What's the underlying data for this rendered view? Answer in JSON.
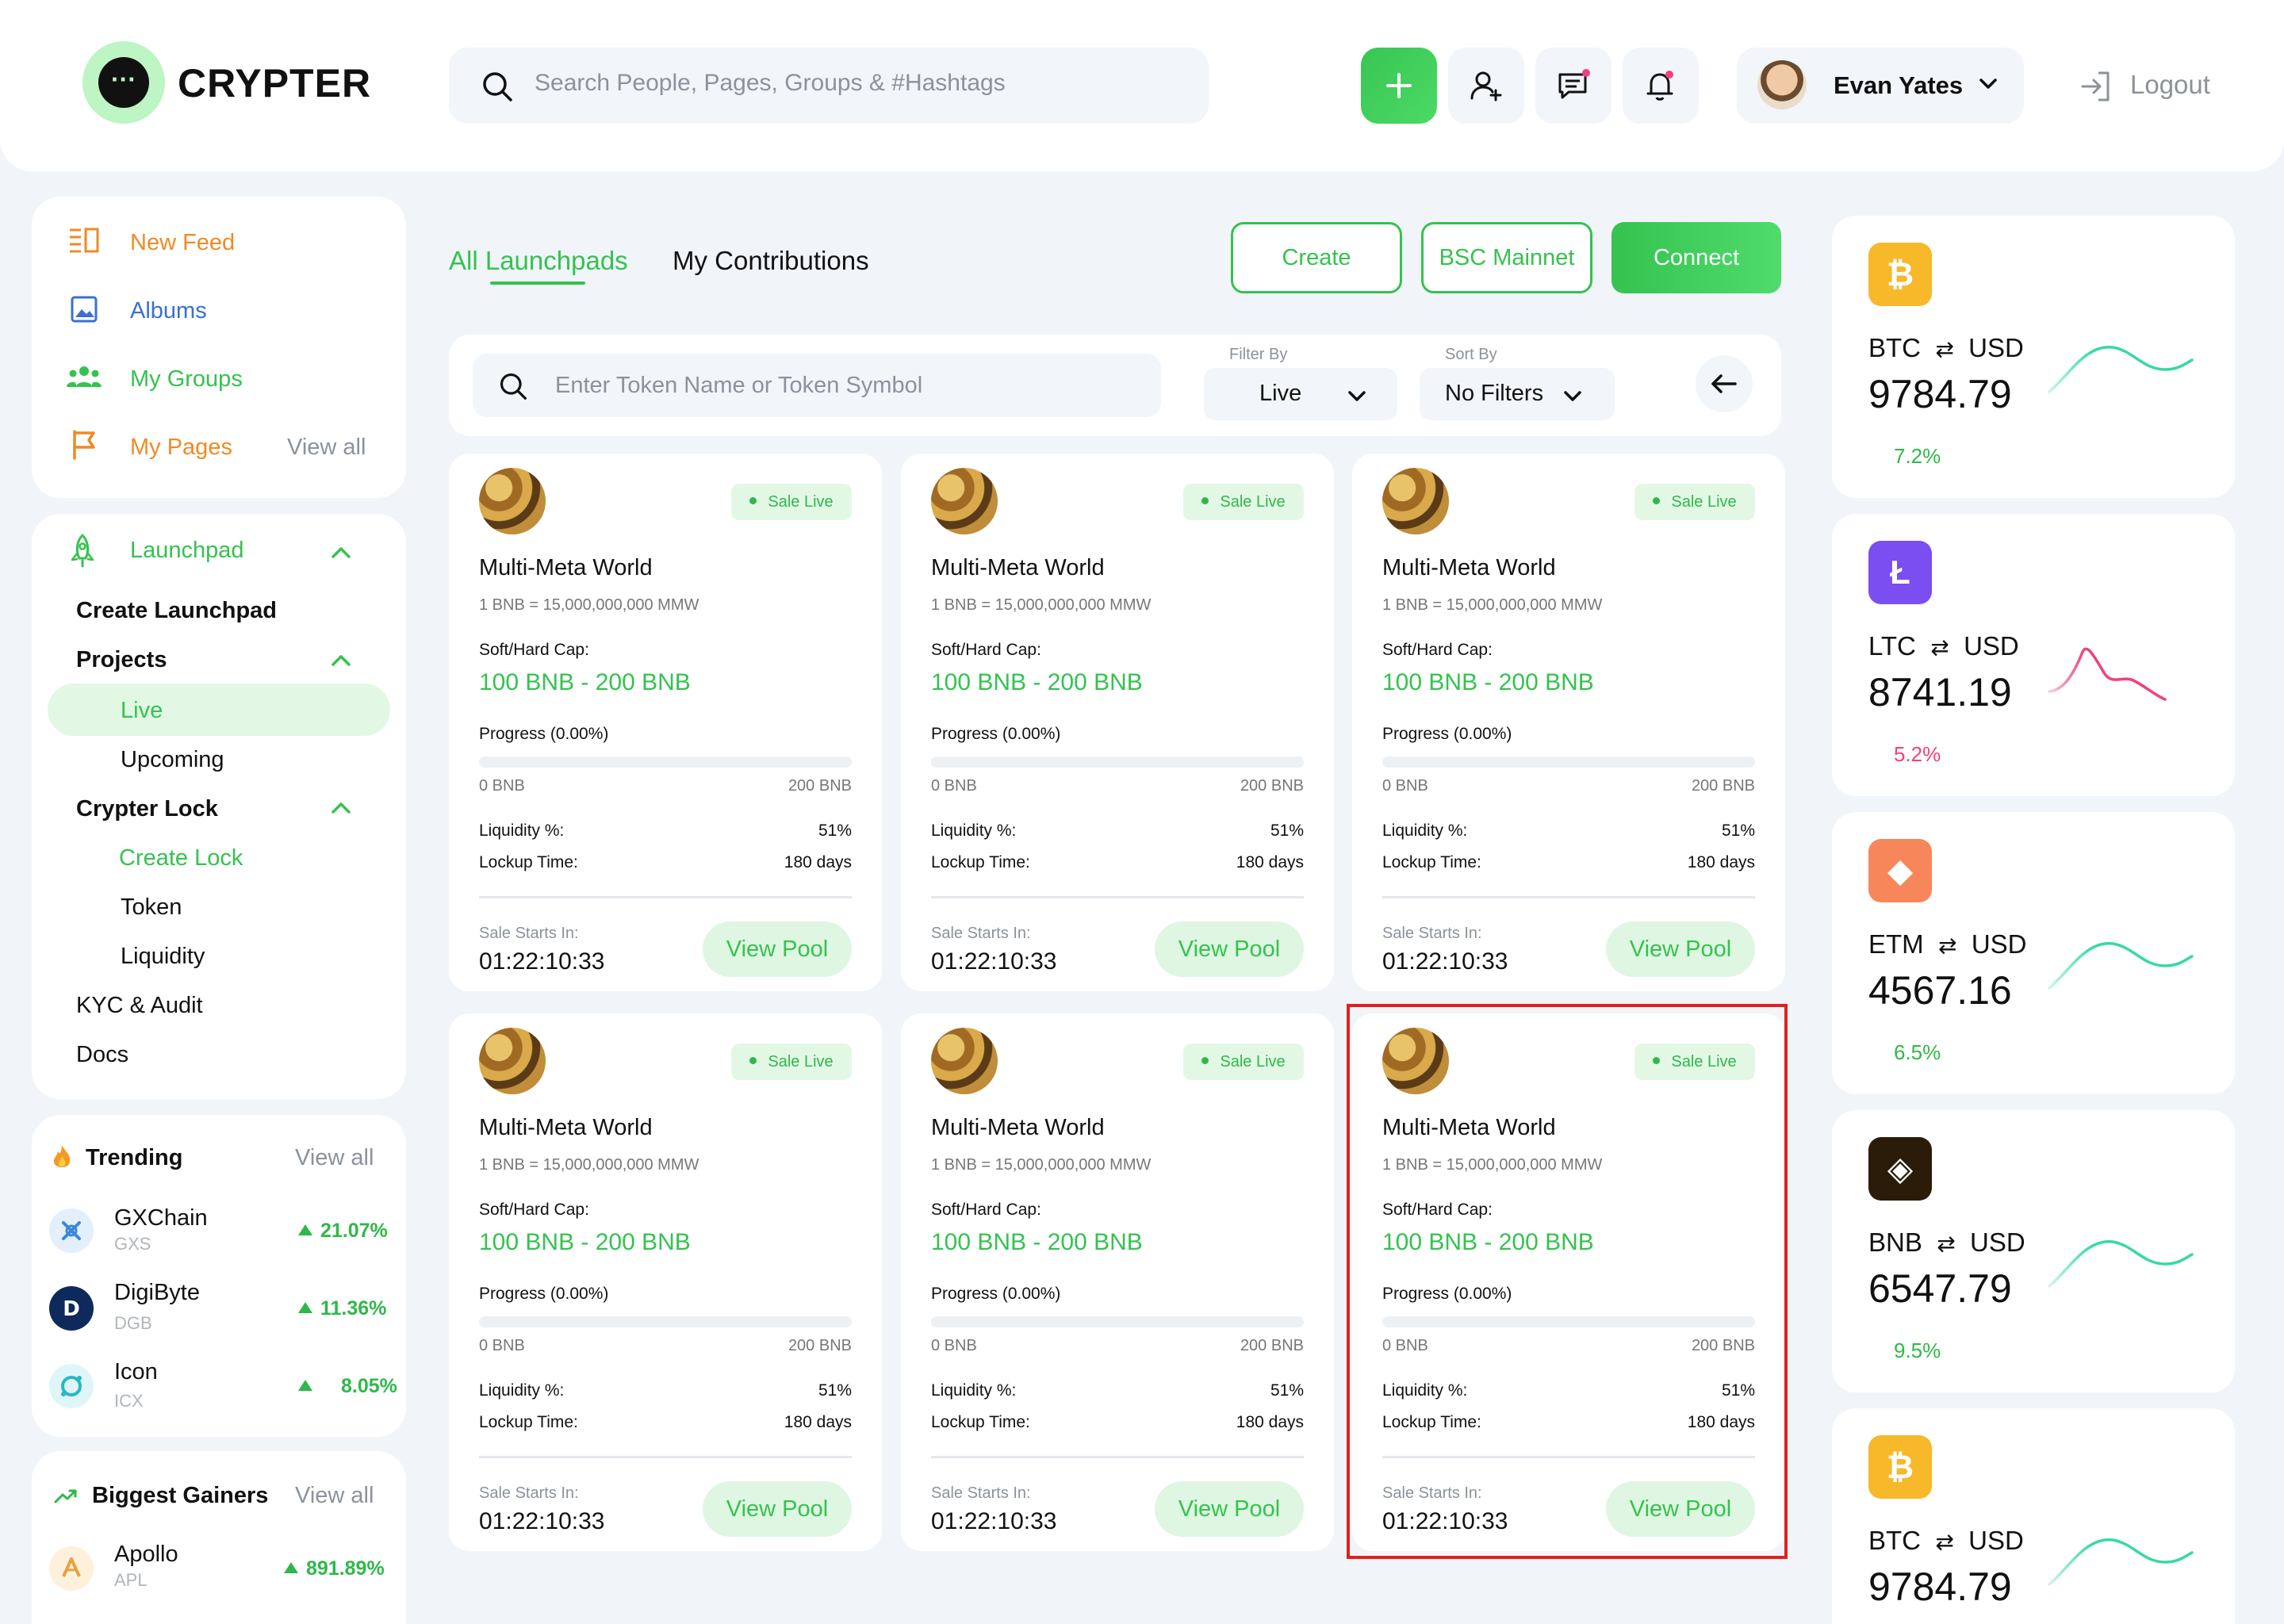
{
  "header": {
    "logo_text": "CRYPTER",
    "logo_mark": "···",
    "search_placeholder": "Search People, Pages, Groups & #Hashtags",
    "user_name": "Evan Yates",
    "logout_label": "Logout"
  },
  "sidebar": {
    "main_nav": [
      {
        "label": "New Feed",
        "icon": "feed-icon"
      },
      {
        "label": "Albums",
        "icon": "image-icon"
      },
      {
        "label": "My Groups",
        "icon": "group-icon"
      },
      {
        "label": "My Pages",
        "icon": "flag-icon"
      }
    ],
    "view_all": "View all",
    "launchpad": {
      "title": "Launchpad",
      "create_launchpad": "Create Launchpad",
      "projects": "Projects",
      "live": "Live",
      "upcoming": "Upcoming",
      "crypter_lock": "Crypter Lock",
      "create_lock": "Create Lock",
      "token": "Token",
      "liquidity": "Liquidity",
      "kyc": "KYC & Audit",
      "docs": "Docs"
    },
    "trending": {
      "title": "Trending",
      "view_all": "View all",
      "items": [
        {
          "name": "GXChain",
          "symbol": "GXS",
          "change": "21.07%"
        },
        {
          "name": "DigiByte",
          "symbol": "DGB",
          "change": "11.36%"
        },
        {
          "name": "Icon",
          "symbol": "ICX",
          "change": "8.05%"
        }
      ]
    },
    "gainers": {
      "title": "Biggest Gainers",
      "view_all": "View all",
      "items": [
        {
          "name": "Apollo",
          "symbol": "APL",
          "change": "891.89%"
        }
      ]
    }
  },
  "tabs": {
    "all": "All Launchpads",
    "mine": "My Contributions"
  },
  "actions": {
    "create": "Create",
    "network": "BSC Mainnet",
    "connect": "Connect"
  },
  "filters": {
    "search_placeholder": "Enter Token Name or Token Symbol",
    "filter_label": "Filter By",
    "filter_value": "Live",
    "sort_label": "Sort By",
    "sort_value": "No Filters"
  },
  "pool_labels": {
    "badge": "Sale Live",
    "cap_label": "Soft/Hard Cap:",
    "min": "0 BNB",
    "max": "200 BNB",
    "liquidity_label": "Liquidity %:",
    "lockup_label": "Lockup Time:",
    "sale_label": "Sale Starts In:",
    "button": "View Pool"
  },
  "pools": [
    {
      "name": "Multi-Meta World",
      "rate": "1 BNB = 15,000,000,000 MMW",
      "cap": "100 BNB - 200 BNB",
      "progress_label": "Progress (0.00%)",
      "progress": 0,
      "liquidity": "51%",
      "lockup": "180 days",
      "timer": "01:22:10:33"
    },
    {
      "name": "Multi-Meta World",
      "rate": "1 BNB = 15,000,000,000 MMW",
      "cap": "100 BNB - 200 BNB",
      "progress_label": "Progress (0.00%)",
      "progress": 0,
      "liquidity": "51%",
      "lockup": "180 days",
      "timer": "01:22:10:33"
    },
    {
      "name": "Multi-Meta World",
      "rate": "1 BNB = 15,000,000,000 MMW",
      "cap": "100 BNB - 200 BNB",
      "progress_label": "Progress (0.00%)",
      "progress": 0,
      "liquidity": "51%",
      "lockup": "180 days",
      "timer": "01:22:10:33"
    },
    {
      "name": "Multi-Meta World",
      "rate": "1 BNB = 15,000,000,000 MMW",
      "cap": "100 BNB - 200 BNB",
      "progress_label": "Progress (0.00%)",
      "progress": 0,
      "liquidity": "51%",
      "lockup": "180 days",
      "timer": "01:22:10:33"
    },
    {
      "name": "Multi-Meta World",
      "rate": "1 BNB = 15,000,000,000 MMW",
      "cap": "100 BNB - 200 BNB",
      "progress_label": "Progress (0.00%)",
      "progress": 0,
      "liquidity": "51%",
      "lockup": "180 days",
      "timer": "01:22:10:33"
    },
    {
      "name": "Multi-Meta World",
      "rate": "1 BNB = 15,000,000,000 MMW",
      "cap": "100 BNB - 200 BNB",
      "progress_label": "Progress (0.00%)",
      "progress": 0,
      "liquidity": "51%",
      "lockup": "180 days",
      "timer": "01:22:10:33"
    }
  ],
  "tickers": [
    {
      "base": "BTC",
      "quote": "USD",
      "price": "9784.79",
      "change": "7.2%",
      "direction": "up",
      "icon_glyph": "₿",
      "color": "#f7b82a",
      "line_color": "#37d9a4"
    },
    {
      "base": "LTC",
      "quote": "USD",
      "price": "8741.19",
      "change": "5.2%",
      "direction": "down",
      "icon_glyph": "Ł",
      "color": "#7a4ef0",
      "line_color": "#f0427a"
    },
    {
      "base": "ETM",
      "quote": "USD",
      "price": "4567.16",
      "change": "6.5%",
      "direction": "up",
      "icon_glyph": "◆",
      "color": "#f7875a",
      "line_color": "#37d9a4"
    },
    {
      "base": "BNB",
      "quote": "USD",
      "price": "6547.79",
      "change": "9.5%",
      "direction": "up",
      "icon_glyph": "◈",
      "color": "#2a1c08",
      "line_color": "#37d9a4"
    },
    {
      "base": "BTC",
      "quote": "USD",
      "price": "9784.79",
      "change": "",
      "direction": "up",
      "icon_glyph": "₿",
      "color": "#f7b82a",
      "line_color": "#37d9a4"
    }
  ],
  "colors": {
    "accent": "#35c24f",
    "orange": "#f08a24",
    "highlight": "#e02020"
  }
}
